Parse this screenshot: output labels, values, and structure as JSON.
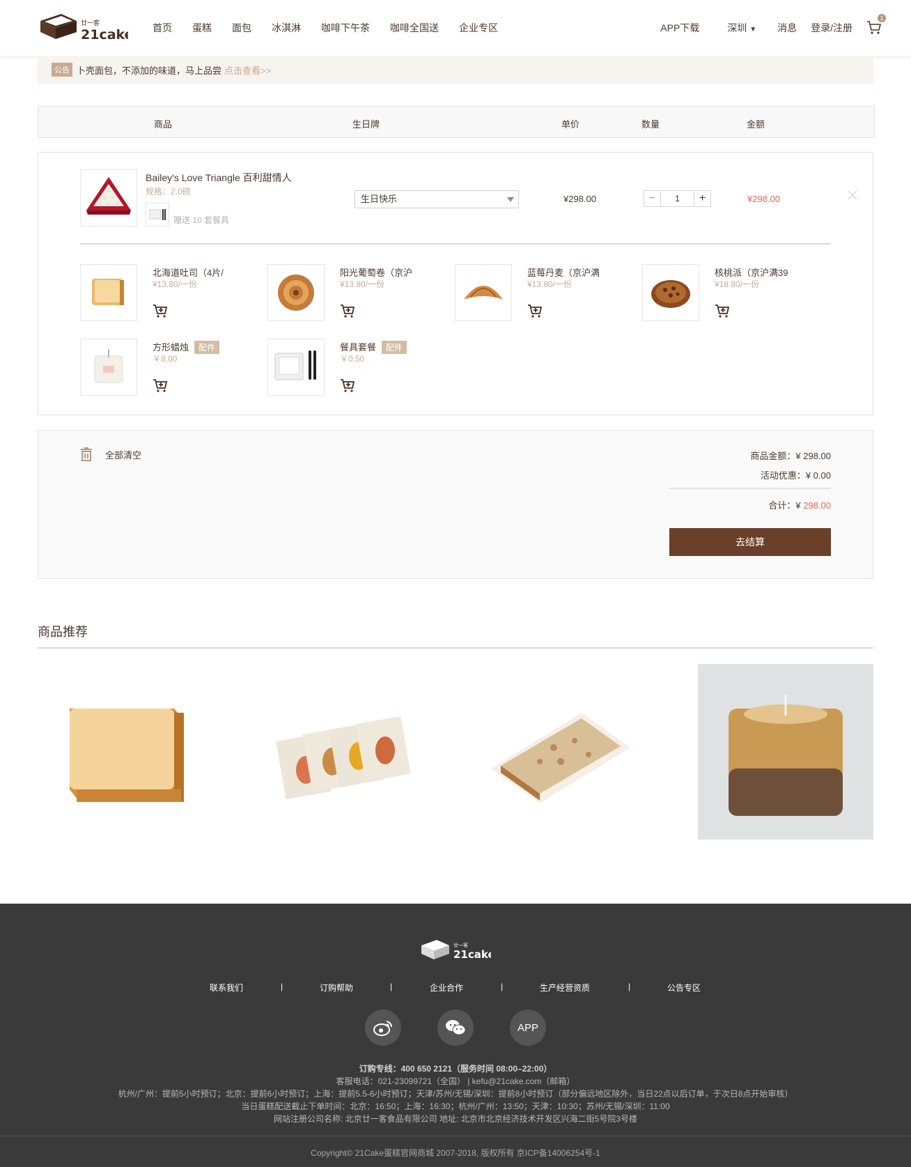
{
  "header": {
    "logo_cn": "廿一客",
    "logo_en": "21cake",
    "nav": [
      "首页",
      "蛋糕",
      "面包",
      "冰淇淋",
      "咖啡下午茶",
      "咖啡全国送",
      "企业专区"
    ],
    "app_download": "APP下载",
    "city": "深圳",
    "messages": "消息",
    "login": "登录/注册",
    "cart_count": "1"
  },
  "notice": {
    "tag": "公告",
    "text": "卜壳面包，不添加的味道，马上品尝",
    "link": "点击查看>>"
  },
  "table_head": {
    "product": "商品",
    "birthday_card": "生日牌",
    "unit_price": "单价",
    "quantity": "数量",
    "amount": "金额"
  },
  "cart_item": {
    "name": "Bailey's Love Triangle 百利甜情人",
    "spec": "规格：2.0磅",
    "gift": "赠送 10 套餐具",
    "card_text": "生日快乐",
    "unit_price": "¥298.00",
    "quantity": "1",
    "total": "¥298.00"
  },
  "addons": [
    {
      "name": "北海道吐司（4片/",
      "price": "¥13.80/一份",
      "tag": ""
    },
    {
      "name": "阳光葡萄卷（京沪",
      "price": "¥13.80/一份",
      "tag": ""
    },
    {
      "name": "蓝莓丹麦（京沪满",
      "price": "¥13.80/一份",
      "tag": ""
    },
    {
      "name": "核桃派（京沪满39",
      "price": "¥18.80/一份",
      "tag": ""
    },
    {
      "name": "方形蜡烛",
      "price": "￥8.00",
      "tag": "配件"
    },
    {
      "name": "餐具套餐",
      "price": "￥0.50",
      "tag": "配件"
    }
  ],
  "summary": {
    "clear_all": "全部清空",
    "goods_amount_label": "商品金额：",
    "goods_amount": "¥ 298.00",
    "discount_label": "活动优惠：",
    "discount": "¥ 0.00",
    "total_label": "合计：",
    "total_currency": "¥ ",
    "total": "298.00",
    "checkout": "去结算"
  },
  "recommend": {
    "title": "商品推荐"
  },
  "footer": {
    "logo_cn": "廿一客",
    "logo_en": "21cake",
    "links": [
      "联系我们",
      "订购帮助",
      "企业合作",
      "生产经营资质",
      "公告专区"
    ],
    "separator": "|",
    "app_label": "APP",
    "hotline": "订购专线：400 650 2121（服务时间 08:00–22:00）",
    "service": "客服电话：021-23099721（全国） | kefu@21cake.com（邮箱）",
    "order_times": "杭州/广州：提前5小时预订；北京：提前6小时预订；上海：提前5.5-6小时预订；天津/苏州/无锡/深圳：提前8小时预订（部分偏远地区除外，当日22点以后订单，于次日8点开始审核）",
    "cutoff": "当日蛋糕配送截止下单时间：北京：16:50；上海：16:30；杭州/广州：13:50；天津：10:30；苏州/无锡/深圳：11:00",
    "company": "网站注册公司名称: 北京廿一客食品有限公司 地址: 北京市北京经济技术开发区兴海二街5号院3号楼",
    "copyright": "Copyright© 21Cake蛋糕官网商城 2007-2018, 版权所有 京ICP备14006254号-1"
  },
  "colors": {
    "brand_brown": "#6b4028",
    "accent_tan": "#c7ab91",
    "price_red": "#e8645a",
    "footer_bg": "#3a3a3a"
  }
}
